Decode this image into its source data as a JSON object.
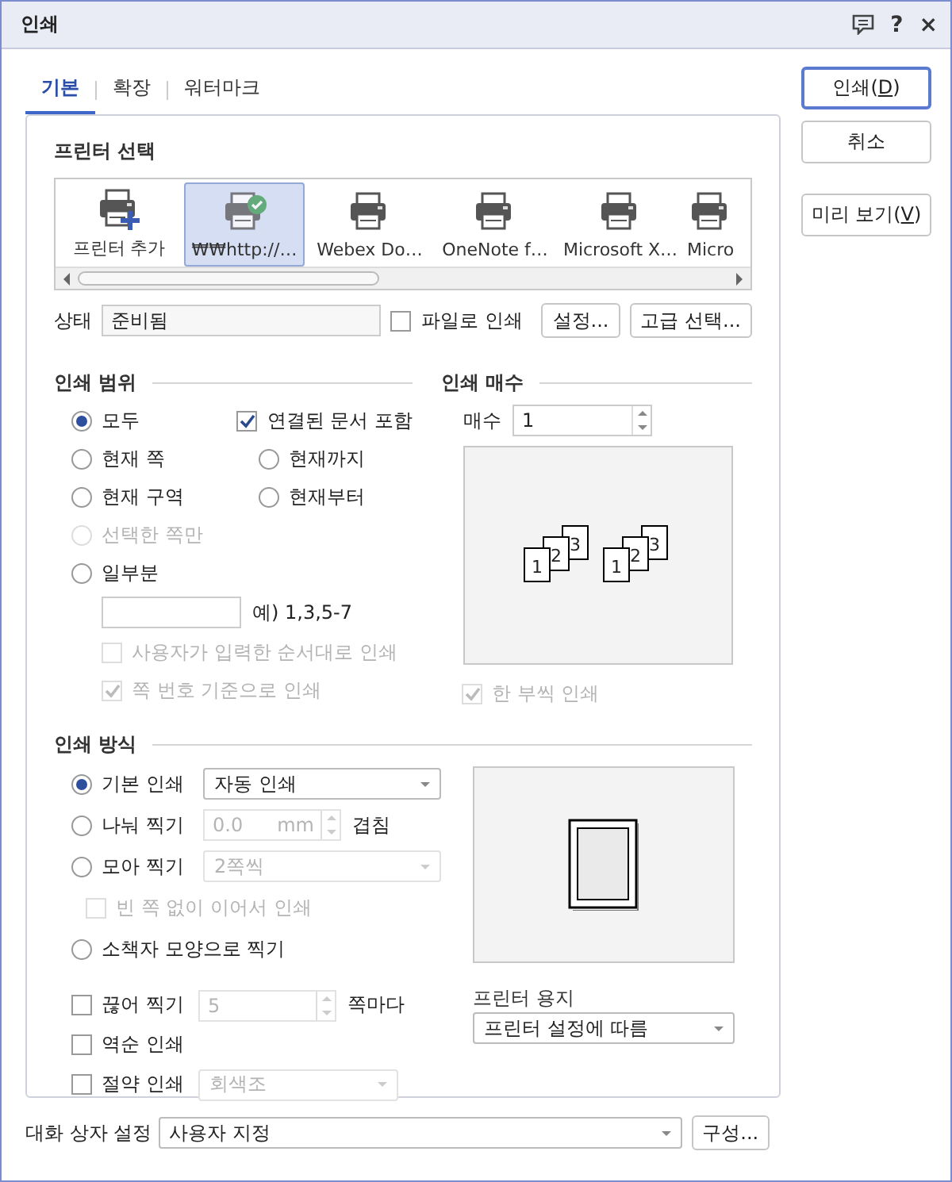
{
  "window": {
    "title": "인쇄",
    "help": "?",
    "close": "×"
  },
  "tabs": [
    {
      "label": "기본",
      "selected": true
    },
    {
      "label": "확장",
      "selected": false
    },
    {
      "label": "워터마크",
      "selected": false
    }
  ],
  "side_buttons": [
    {
      "before": "인쇄(",
      "key": "D",
      "after": ")",
      "default": true
    },
    {
      "before": "취소",
      "default": false
    },
    {
      "before": "미리 보기(",
      "key": "V",
      "after": ")",
      "default": false
    }
  ],
  "printer_select": {
    "title": "프린터 선택",
    "printers": [
      {
        "name": "프린터 추가",
        "kind": "add",
        "selected": false
      },
      {
        "name": "₩₩http://…",
        "kind": "default",
        "selected": true
      },
      {
        "name": "Webex Do…",
        "kind": "printer",
        "selected": false
      },
      {
        "name": "OneNote f…",
        "kind": "printer",
        "selected": false
      },
      {
        "name": "Microsoft X…",
        "kind": "printer",
        "selected": false
      },
      {
        "name": "Micro",
        "kind": "printer",
        "selected": false
      }
    ]
  },
  "status": {
    "label": "상태",
    "value": "준비됨"
  },
  "print_to_file": {
    "label": "파일로 인쇄",
    "checked": false
  },
  "printer_buttons": [
    "설정...",
    "고급 선택..."
  ],
  "range": {
    "title": "인쇄 범위",
    "rows": [
      [
        {
          "kind": "radio",
          "label": "모두",
          "selected": true,
          "disabled": false
        },
        {
          "kind": "checkbox",
          "label": "연결된 문서 포함",
          "checked": true,
          "disabled": false
        }
      ],
      [
        {
          "kind": "radio",
          "label": "현재 쪽",
          "selected": false,
          "disabled": false
        },
        {
          "kind": "radio",
          "label": "현재까지",
          "selected": false,
          "disabled": false
        }
      ],
      [
        {
          "kind": "radio",
          "label": "현재 구역",
          "selected": false,
          "disabled": false
        },
        {
          "kind": "radio",
          "label": "현재부터",
          "selected": false,
          "disabled": false
        }
      ],
      [
        {
          "kind": "radio",
          "label": "선택한 쪽만",
          "selected": false,
          "disabled": true
        }
      ],
      [
        {
          "kind": "radio",
          "label": "일부분",
          "selected": false,
          "disabled": false
        }
      ]
    ],
    "example": "예) 1,3,5-7",
    "options": [
      {
        "label": "사용자가 입력한 순서대로 인쇄",
        "checked": false,
        "disabled": true
      },
      {
        "label": "쪽 번호 기준으로 인쇄",
        "checked": true,
        "disabled": true
      }
    ]
  },
  "copies": {
    "title": "인쇄 매수",
    "label": "매수",
    "value": "1",
    "sets": [
      [
        "1",
        "2",
        "3"
      ],
      [
        "1",
        "2",
        "3"
      ]
    ],
    "collate": {
      "label": "한 부씩 인쇄",
      "checked": true,
      "disabled": true
    }
  },
  "method": {
    "title": "인쇄 방식",
    "rows": [
      {
        "kind": "radio",
        "label": "기본 인쇄",
        "selected": true,
        "disabled": false,
        "control": {
          "kind": "select",
          "value": "자동 인쇄",
          "disabled": false
        }
      },
      {
        "kind": "radio",
        "label": "나눠 찍기",
        "selected": false,
        "disabled": false,
        "control": {
          "kind": "spin",
          "value": "0.0",
          "unit": "mm",
          "disabled": true
        },
        "suffix": "겹침"
      },
      {
        "kind": "radio",
        "label": "모아 찍기",
        "selected": false,
        "disabled": false,
        "control": {
          "kind": "select",
          "value": "2쪽씩",
          "disabled": true
        }
      },
      {
        "kind": "checkbox",
        "label": "빈 쪽 없이 이어서 인쇄",
        "checked": false,
        "disabled": true
      },
      {
        "kind": "radio",
        "label": "소책자 모양으로 찍기",
        "selected": false,
        "disabled": false
      }
    ],
    "options": [
      {
        "kind": "checkbox",
        "label": "끊어 찍기",
        "checked": false,
        "disabled": false,
        "control": {
          "kind": "spin",
          "value": "5",
          "disabled": true
        },
        "suffix": "쪽마다"
      },
      {
        "kind": "checkbox",
        "label": "역순 인쇄",
        "checked": false,
        "disabled": false
      },
      {
        "kind": "checkbox",
        "label": "절약 인쇄",
        "checked": false,
        "disabled": false,
        "control": {
          "kind": "select",
          "value": "회색조",
          "disabled": true
        }
      }
    ]
  },
  "paper": {
    "title": "프린터 용지",
    "value": "프린터 설정에 따름"
  },
  "footer": {
    "label": "대화 상자 설정",
    "value": "사용자 지정",
    "button": "구성..."
  }
}
